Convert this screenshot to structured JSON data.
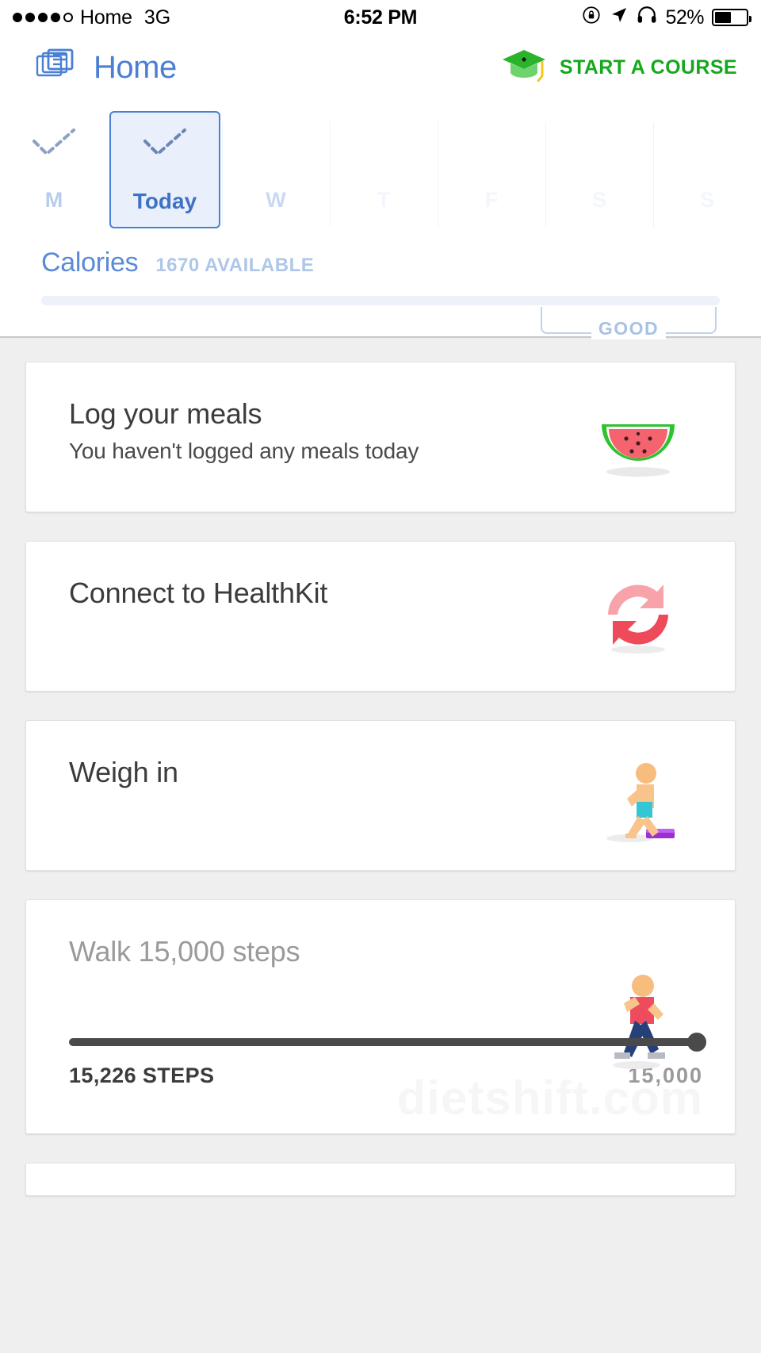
{
  "status_bar": {
    "signal_dots_filled": 4,
    "signal_dots_total": 5,
    "carrier": "Home",
    "network": "3G",
    "time": "6:52 PM",
    "icons": [
      "rotation-lock-icon",
      "location-arrow-icon",
      "headphones-icon"
    ],
    "battery_percent": "52%",
    "battery_level": 52
  },
  "nav": {
    "title": "Home",
    "home_icon": "stacked-cards-icon",
    "course_button": {
      "label": "START A COURSE",
      "icon": "graduation-cap-icon",
      "color": "#16a81c"
    },
    "title_color": "#4a7fd4"
  },
  "days": [
    {
      "label": "M",
      "selected": false,
      "has_check": true,
      "dim": false
    },
    {
      "label": "Today",
      "selected": true,
      "has_check": true,
      "dim": false
    },
    {
      "label": "W",
      "selected": false,
      "has_check": false,
      "dim": false
    },
    {
      "label": "T",
      "selected": false,
      "has_check": false,
      "dim": true
    },
    {
      "label": "F",
      "selected": false,
      "has_check": false,
      "dim": true
    },
    {
      "label": "S",
      "selected": false,
      "has_check": false,
      "dim": true
    },
    {
      "label": "S",
      "selected": false,
      "has_check": false,
      "dim": true
    }
  ],
  "calories": {
    "title": "Calories",
    "available": "1670 AVAILABLE",
    "progress_percent": 0,
    "range_label": "GOOD",
    "title_color": "#5a8ad8",
    "bar_color": "#edf2fa"
  },
  "cards": [
    {
      "title": "Log your meals",
      "subtitle": "You haven't logged any meals today",
      "art": "watermelon-icon"
    },
    {
      "title": "Connect to HealthKit",
      "subtitle": "",
      "art": "sync-arrows-icon"
    },
    {
      "title": "Weigh in",
      "subtitle": "",
      "art": "person-on-scale-icon"
    }
  ],
  "steps_card": {
    "title": "Walk 15,000 steps",
    "art": "walking-person-icon",
    "current_label": "15,226 STEPS",
    "goal_label": "15,000",
    "current_value": 15226,
    "goal_value": 15000,
    "progress_percent": 100
  },
  "watermark": "dietshift.com"
}
